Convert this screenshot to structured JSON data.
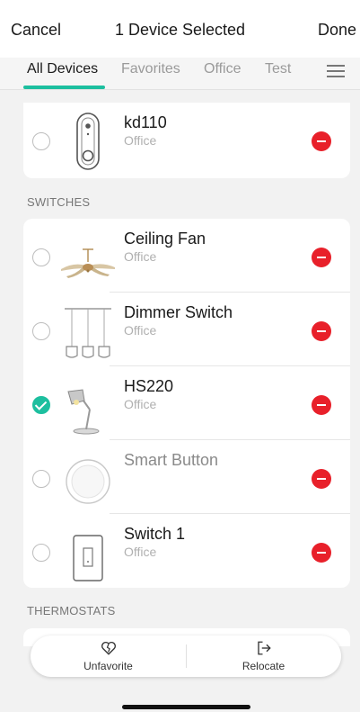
{
  "header": {
    "cancel_label": "Cancel",
    "title": "1 Device Selected",
    "done_label": "Done"
  },
  "tabs": [
    {
      "label": "All Devices",
      "active": true
    },
    {
      "label": "Favorites",
      "active": false
    },
    {
      "label": "Office",
      "active": false
    },
    {
      "label": "Test",
      "active": false
    }
  ],
  "menu_icon": "hamburger-menu-icon",
  "sections": [
    {
      "heading": "",
      "devices": [
        {
          "name": "kd110",
          "room": "Office",
          "selected": false,
          "icon": "doorbell-icon"
        }
      ]
    },
    {
      "heading": "SWITCHES",
      "devices": [
        {
          "name": "Ceiling Fan",
          "room": "Office",
          "selected": false,
          "icon": "ceiling-fan-icon"
        },
        {
          "name": "Dimmer Switch",
          "room": "Office",
          "selected": false,
          "icon": "pendant-lights-icon"
        },
        {
          "name": "HS220",
          "room": "Office",
          "selected": true,
          "icon": "desk-lamp-icon"
        },
        {
          "name": "Smart Button",
          "room": "",
          "selected": false,
          "icon": "smart-button-icon"
        },
        {
          "name": "Switch 1",
          "room": "Office",
          "selected": false,
          "icon": "wall-switch-icon"
        }
      ]
    },
    {
      "heading": "THERMOSTATS",
      "devices": []
    }
  ],
  "actions": {
    "unfavorite_label": "Unfavorite",
    "relocate_label": "Relocate"
  },
  "colors": {
    "accent": "#1dbf9f",
    "remove": "#e8202a",
    "background": "#f2f2f2"
  }
}
